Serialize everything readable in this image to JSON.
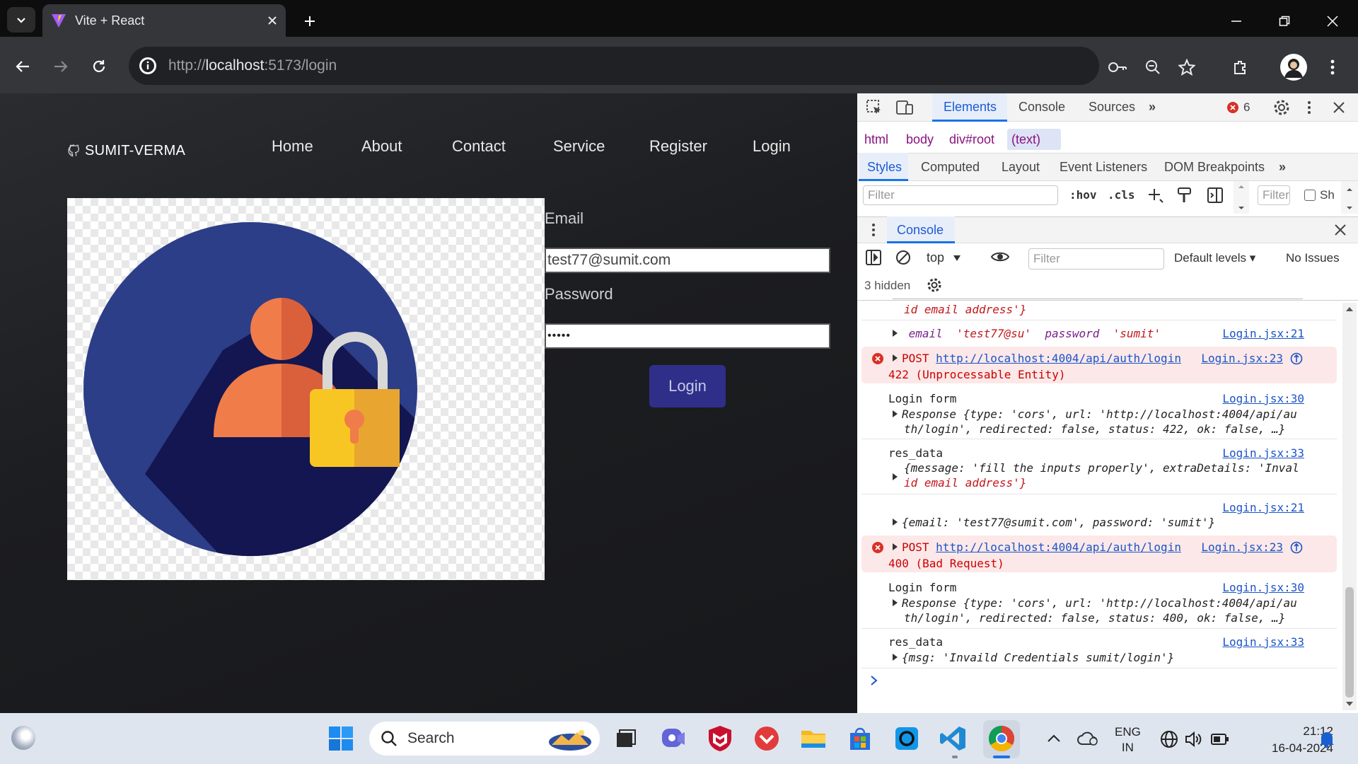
{
  "browser": {
    "tab_title": "Vite + React",
    "url_prefix": "http://",
    "url_host": "localhost",
    "url_rest": ":5173/login"
  },
  "site": {
    "logo_text": "SUMIT-VERMA",
    "nav": [
      "Home",
      "About",
      "Contact",
      "Service",
      "Register",
      "Login"
    ],
    "form": {
      "email_label": "Email",
      "email_value": "test77@sumit.com",
      "password_label": "Password",
      "password_value": "•••••",
      "login_button": "Login"
    }
  },
  "devtools": {
    "tabs": [
      "Elements",
      "Console",
      "Sources"
    ],
    "error_count": "6",
    "breadcrumbs": [
      "html",
      "body",
      "div#root",
      "(text)"
    ],
    "style_tabs": [
      "Styles",
      "Computed",
      "Layout",
      "Event Listeners",
      "DOM Breakpoints"
    ],
    "styles_filter_placeholder": "Filter",
    "hov": ":hov",
    "cls": ".cls",
    "computed_filter_placeholder": "Filter",
    "show_all_label": "Sh",
    "drawer_title": "Console",
    "context": "top",
    "console_filter_placeholder": "Filter",
    "levels": "Default levels ▾",
    "issues": "No Issues",
    "hidden": "3 hidden",
    "log": {
      "l1_cont": "id email address'}",
      "l2_obj": {
        "k1": "email",
        "v1": "'test77@su'",
        "k2": "password",
        "v2": "'sumit'"
      },
      "l2_src": "Login.jsx:21",
      "e1_method": "POST",
      "e1_url": "http://localhost:4004/api/auth/login",
      "e1_src": "Login.jsx:23",
      "e1_status": "422 (Unprocessable Entity)",
      "lf1_label": "Login form",
      "lf1_src": "Login.jsx:30",
      "lf1_line1": "Response {type: 'cors', url: 'http://localhost:4004/api/au",
      "lf1_line2": "th/login', redirected: false, status: 422, ok: false, …}",
      "rd1_label": "res_data",
      "rd1_src": "Login.jsx:33",
      "rd1_line1": "{message: 'fill the inputs properly', extraDetails: 'Inval",
      "rd1_line2": "id email address'}",
      "l3_src": "Login.jsx:21",
      "l3_line": "{email: 'test77@sumit.com', password: 'sumit'}",
      "e2_method": "POST",
      "e2_url": "http://localhost:4004/api/auth/login",
      "e2_src": "Login.jsx:23",
      "e2_status": "400 (Bad Request)",
      "lf2_label": "Login form",
      "lf2_src": "Login.jsx:30",
      "lf2_line1": "Response {type: 'cors', url: 'http://localhost:4004/api/au",
      "lf2_line2": "th/login', redirected: false, status: 400, ok: false, …}",
      "rd2_label": "res_data",
      "rd2_src": "Login.jsx:33",
      "rd2_line": "{msg: 'Invaild Credentials sumit/login'}"
    }
  },
  "taskbar": {
    "search": "Search",
    "lang1": "ENG",
    "lang2": "IN",
    "time": "21:12",
    "date": "16-04-2024"
  }
}
